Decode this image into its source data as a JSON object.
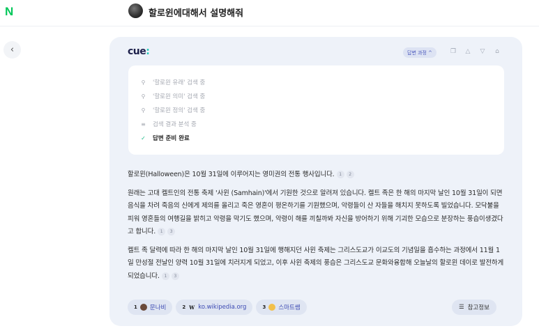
{
  "header": {
    "logo": "N",
    "query": "할로윈에대해서 설명해줘"
  },
  "nav": {
    "back_icon": "chevron-left-icon",
    "back_glyph": "‹"
  },
  "card": {
    "brand": "cue",
    "brand_colon": ":",
    "process_label": "답변 과정",
    "process_chevron": "^",
    "steps": [
      {
        "icon": "search-icon",
        "glyph": "⚲",
        "text": "'할로윈 유래' 검색 중"
      },
      {
        "icon": "search-icon",
        "glyph": "⚲",
        "text": "'할로윈 의미' 검색 중"
      },
      {
        "icon": "search-icon",
        "glyph": "⚲",
        "text": "'할로윈 정의' 검색 중"
      },
      {
        "icon": "lines-icon",
        "glyph": "≡",
        "text": "검색 결과 분석 중"
      },
      {
        "icon": "check-icon",
        "glyph": "✓",
        "text": "답변 준비 완료"
      }
    ],
    "answer": [
      {
        "text": "할로윈(Halloween)은 10월 31일에 이루어지는 영미권의 전통 행사입니다.",
        "cites": [
          "1",
          "2"
        ]
      },
      {
        "text": "원래는 고대 켈트인의 전통 축제 '사윈 (Samhain)'에서 기원한 것으로 알려져 있습니다. 켈트 족은 한 해의 마지막 날인 10월 31일이 되면 음식을 차려 죽음의 신에게 제의를 올리고 죽은 영혼이 평온하기를 기원했으며, 악령들이 산 자들을 해치지 못하도록 빌었습니다. 모닥불을 피워 영혼들의 여행길을 밝히고 악령을 막기도 했으며, 악령이 해를 끼칠까봐 자신을 방어하기 위해 기괴한 모습으로 분장하는 풍습이생겼다고 합니다.",
        "cites": [
          "1",
          "3"
        ]
      },
      {
        "text": "켈트 족 달력에 따라 한 해의 마지막 날인 10월 31일에 행해지던 사윈 축제는 그리스도교가 이교도의 기념일을 흡수하는 과정에서 11월 1일 만성절 전날인 양력 10월 31일에 치러지게 되었고, 이후 사윈 축제의 풍습은 그리스도교 문화와융합해 오늘날의 할로윈 데이로 발전하게 되었습니다.",
        "cites": [
          "1",
          "3"
        ]
      }
    ],
    "sources": [
      {
        "num": "1",
        "icon": "munabi-icon",
        "glyph": "●",
        "label": "문나비"
      },
      {
        "num": "2",
        "icon": "wikipedia-icon",
        "glyph": "W",
        "label": "ko.wikipedia.org"
      },
      {
        "num": "3",
        "icon": "smart-icon",
        "glyph": "●",
        "label": "스마트쌤"
      }
    ],
    "ref_label": "참고정보",
    "ref_icon": "list-icon",
    "ref_glyph": "☰",
    "toolbar_icons": [
      {
        "name": "copy-icon",
        "glyph": "❐"
      },
      {
        "name": "thumbs-up-icon",
        "glyph": "△"
      },
      {
        "name": "thumbs-down-icon",
        "glyph": "▽"
      },
      {
        "name": "save-icon",
        "glyph": "⌂"
      }
    ]
  }
}
